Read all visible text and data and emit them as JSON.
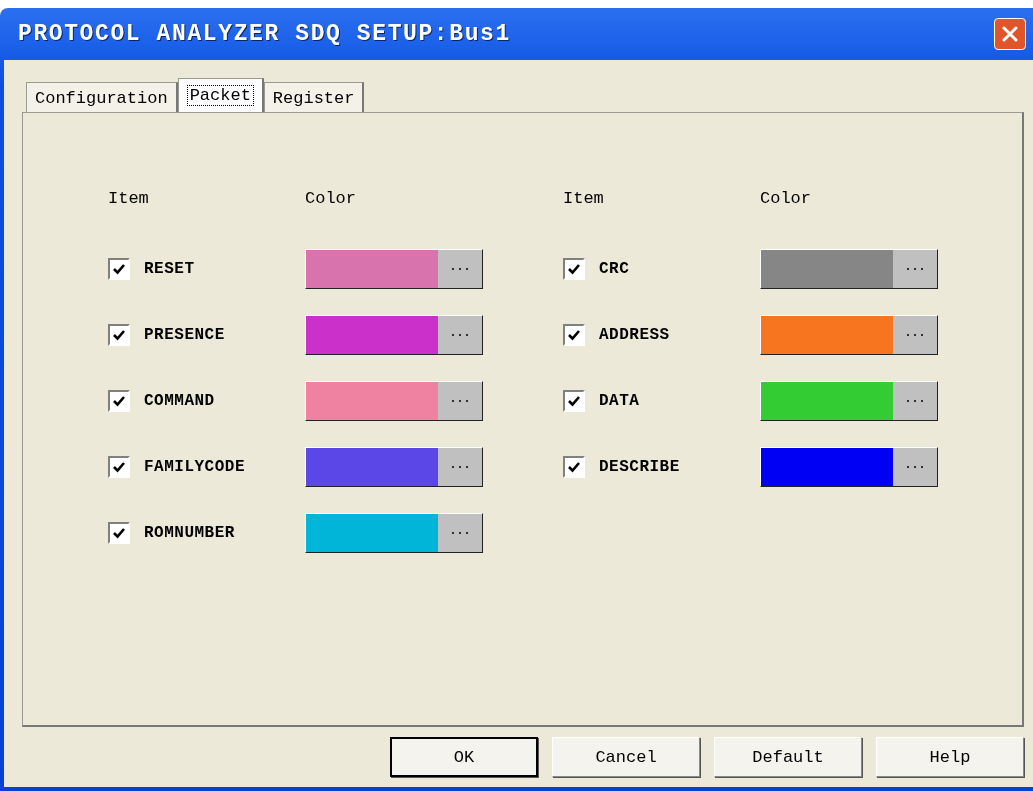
{
  "window": {
    "title": "PROTOCOL ANALYZER SDQ SETUP:Bus1"
  },
  "tabs": [
    {
      "label": "Configuration",
      "selected": false
    },
    {
      "label": "Packet",
      "selected": true
    },
    {
      "label": "Register",
      "selected": false
    }
  ],
  "groups": [
    {
      "item_header": "Item",
      "color_header": "Color",
      "items": [
        {
          "label": "RESET",
          "checked": true,
          "color": "#d873ae"
        },
        {
          "label": "PRESENCE",
          "checked": true,
          "color": "#cb30cb"
        },
        {
          "label": "COMMAND",
          "checked": true,
          "color": "#ee82a0"
        },
        {
          "label": "FAMILYCODE",
          "checked": true,
          "color": "#5b46e8"
        },
        {
          "label": "ROMNUMBER",
          "checked": true,
          "color": "#00b5d8"
        }
      ]
    },
    {
      "item_header": "Item",
      "color_header": "Color",
      "items": [
        {
          "label": "CRC",
          "checked": true,
          "color": "#868686"
        },
        {
          "label": "ADDRESS",
          "checked": true,
          "color": "#f87520"
        },
        {
          "label": "DATA",
          "checked": true,
          "color": "#33cc33"
        },
        {
          "label": "DESCRIBE",
          "checked": true,
          "color": "#0000f5"
        }
      ]
    }
  ],
  "buttons": [
    {
      "label": "OK",
      "default": true
    },
    {
      "label": "Cancel",
      "default": false
    },
    {
      "label": "Default",
      "default": false
    },
    {
      "label": "Help",
      "default": false
    }
  ]
}
